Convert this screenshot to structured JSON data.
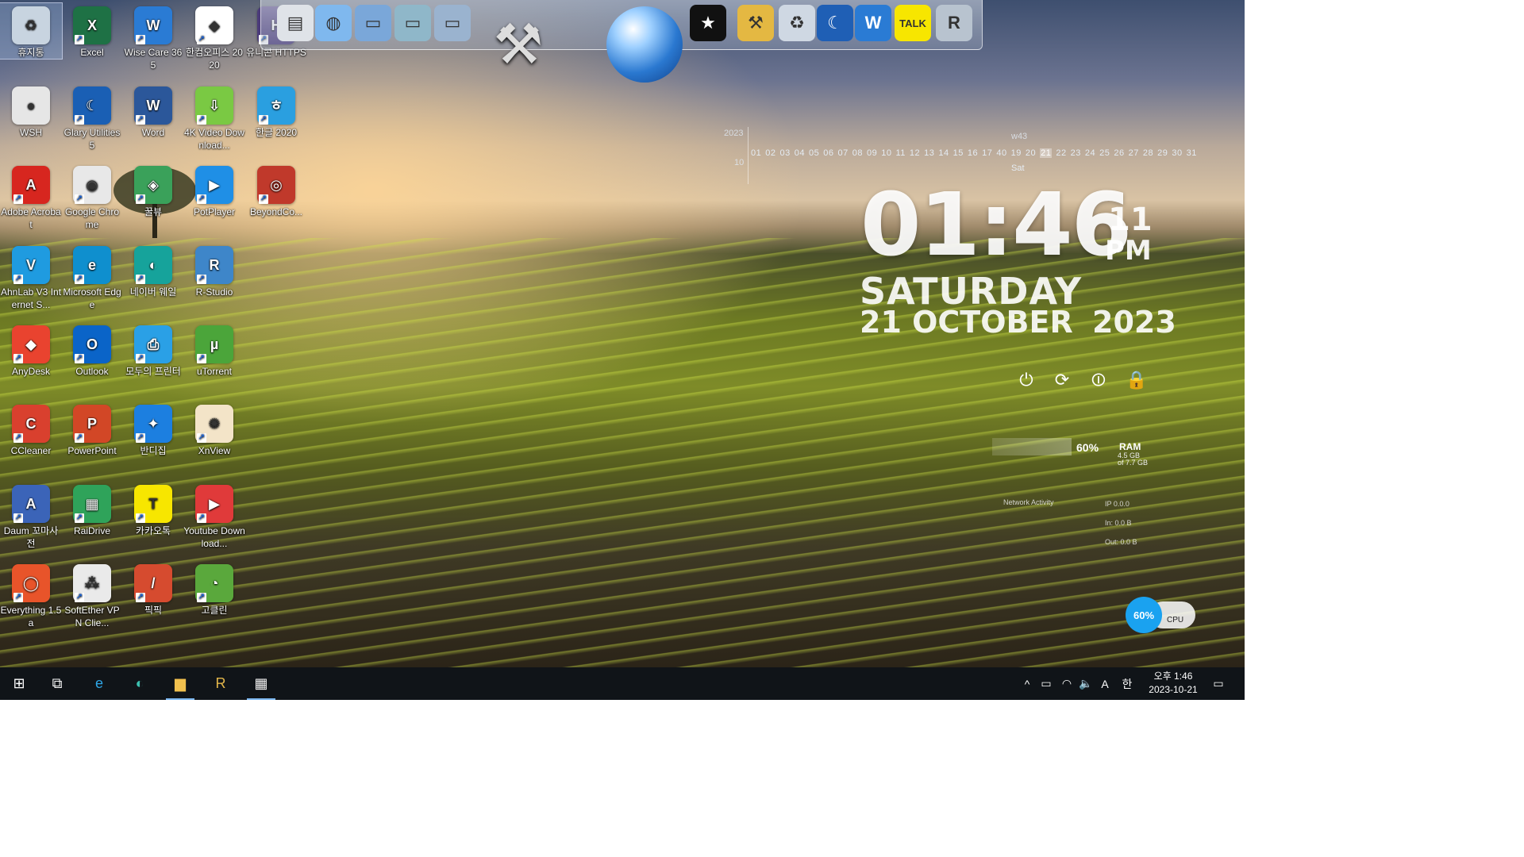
{
  "desktop_icons": [
    {
      "label": "휴지통",
      "color": "#c8d4e0",
      "glyph": "♻",
      "col": 0,
      "row": 0,
      "selected": true,
      "shortcut": false
    },
    {
      "label": "Excel",
      "color": "#1e7145",
      "glyph": "X",
      "col": 1,
      "row": 0
    },
    {
      "label": "Wise Care 365",
      "color": "#2a7bd4",
      "glyph": "W",
      "col": 2,
      "row": 0
    },
    {
      "label": "한컴오피스 2020",
      "color": "#ffffff",
      "glyph": "◆",
      "col": 3,
      "row": 0
    },
    {
      "label": "유니콘 HTTPS",
      "color": "#4b3b7a",
      "glyph": "H",
      "col": 4,
      "row": 0
    },
    {
      "label": "WSH",
      "color": "#e6e6e6",
      "glyph": "●",
      "col": 0,
      "row": 1,
      "shortcut": false
    },
    {
      "label": "Glary Utilities 5",
      "color": "#1a5fb4",
      "glyph": "☾",
      "col": 1,
      "row": 1
    },
    {
      "label": "Word",
      "color": "#2b579a",
      "glyph": "W",
      "col": 2,
      "row": 1
    },
    {
      "label": "4K Video Download...",
      "color": "#7ac943",
      "glyph": "⇩",
      "col": 3,
      "row": 1
    },
    {
      "label": "한글 2020",
      "color": "#2a9fe0",
      "glyph": "ㅎ",
      "col": 4,
      "row": 1
    },
    {
      "label": "Adobe Acrobat",
      "color": "#d7261f",
      "glyph": "A",
      "col": 0,
      "row": 2
    },
    {
      "label": "Google Chrome",
      "color": "#e8e8e8",
      "glyph": "◉",
      "col": 1,
      "row": 2
    },
    {
      "label": "꿀뷰",
      "color": "#3aa15a",
      "glyph": "◈",
      "col": 2,
      "row": 2
    },
    {
      "label": "PotPlayer",
      "color": "#1f8fe6",
      "glyph": "▶",
      "col": 3,
      "row": 2
    },
    {
      "label": "BeyondCo...",
      "color": "#c0392b",
      "glyph": "◎",
      "col": 4,
      "row": 2
    },
    {
      "label": "AhnLab V3 Internet S...",
      "color": "#1f9be0",
      "glyph": "V",
      "col": 0,
      "row": 3
    },
    {
      "label": "Microsoft Edge",
      "color": "#0f8fce",
      "glyph": "e",
      "col": 1,
      "row": 3
    },
    {
      "label": "네이버 웨일",
      "color": "#16a39b",
      "glyph": "◐",
      "col": 2,
      "row": 3
    },
    {
      "label": "R-Studio",
      "color": "#3e86c9",
      "glyph": "R",
      "col": 3,
      "row": 3
    },
    {
      "label": "AnyDesk",
      "color": "#e9432f",
      "glyph": "◆",
      "col": 0,
      "row": 4
    },
    {
      "label": "Outlook",
      "color": "#0a64c8",
      "glyph": "O",
      "col": 1,
      "row": 4
    },
    {
      "label": "모두의 프린터",
      "color": "#2aa0e6",
      "glyph": "⎙",
      "col": 2,
      "row": 4
    },
    {
      "label": "uTorrent",
      "color": "#4ba53a",
      "glyph": "µ",
      "col": 3,
      "row": 4
    },
    {
      "label": "CCleaner",
      "color": "#d9402e",
      "glyph": "C",
      "col": 0,
      "row": 5
    },
    {
      "label": "PowerPoint",
      "color": "#d24726",
      "glyph": "P",
      "col": 1,
      "row": 5
    },
    {
      "label": "반디집",
      "color": "#1c7fe0",
      "glyph": "✦",
      "col": 2,
      "row": 5
    },
    {
      "label": "XnView",
      "color": "#f3e4c8",
      "glyph": "✺",
      "col": 3,
      "row": 5
    },
    {
      "label": "Daum 꼬마사전",
      "color": "#3b64b8",
      "glyph": "A",
      "col": 0,
      "row": 6
    },
    {
      "label": "RaiDrive",
      "color": "#2fa35a",
      "glyph": "▦",
      "col": 1,
      "row": 6
    },
    {
      "label": "카카오톡",
      "color": "#f7e600",
      "glyph": "T",
      "col": 2,
      "row": 6
    },
    {
      "label": "Youtube Download...",
      "color": "#e03a3a",
      "glyph": "▶",
      "col": 3,
      "row": 6
    },
    {
      "label": "Everything 1.5a",
      "color": "#e8542a",
      "glyph": "◯",
      "col": 0,
      "row": 7
    },
    {
      "label": "SoftEther VPN Clie...",
      "color": "#eaeaea",
      "glyph": "⁂",
      "col": 1,
      "row": 7
    },
    {
      "label": "픽픽",
      "color": "#d64b2f",
      "glyph": "/",
      "col": 2,
      "row": 7
    },
    {
      "label": "고클린",
      "color": "#5aa83c",
      "glyph": "◔",
      "col": 3,
      "row": 7
    }
  ],
  "dock_items": [
    {
      "name": "notepad-icon",
      "glyph": "▤",
      "color": "#dfe3e8"
    },
    {
      "name": "network-globe-icon",
      "glyph": "◍",
      "color": "#7fb8ee"
    },
    {
      "name": "folder-icon",
      "glyph": "▭",
      "color": "#7aa7d9"
    },
    {
      "name": "folder-green-icon",
      "glyph": "▭",
      "color": "#8fb7c9"
    },
    {
      "name": "folder-open-icon",
      "glyph": "▭",
      "color": "#9ab3cf"
    },
    {
      "name": "tshirt-icon",
      "glyph": "★",
      "color": "#111111"
    },
    {
      "name": "hammer-tool-icon",
      "glyph": "⚒",
      "color": "#e4b842"
    },
    {
      "name": "recycle-bin-icon",
      "glyph": "♻",
      "color": "#cfd8e3"
    },
    {
      "name": "glary-icon",
      "glyph": "☾",
      "color": "#1f5fb5"
    },
    {
      "name": "wise-shield-icon",
      "glyph": "W",
      "color": "#2a7bd4"
    },
    {
      "name": "kakaotalk-icon",
      "glyph": "TALK",
      "color": "#f7e600"
    },
    {
      "name": "r-studio-dock-icon",
      "glyph": "R",
      "color": "#b8c3cf"
    }
  ],
  "calendar": {
    "year": "2023",
    "week": "w43",
    "month": "10",
    "days": [
      "01",
      "02",
      "03",
      "04",
      "05",
      "06",
      "07",
      "08",
      "09",
      "10",
      "11",
      "12",
      "13",
      "14",
      "15",
      "16",
      "17",
      "40",
      "19",
      "20",
      "21",
      "22",
      "23",
      "24",
      "25",
      "26",
      "27",
      "28",
      "29",
      "30",
      "31"
    ],
    "today": "21",
    "day_of_week": "Sat"
  },
  "clock": {
    "time": "01:46",
    "seconds": "11",
    "ampm": "PM",
    "day": "SATURDAY",
    "date": "21 OCTOBER",
    "year": "2023"
  },
  "power_buttons": [
    {
      "name": "shutdown-icon",
      "glyph": "⏻"
    },
    {
      "name": "restart-icon",
      "glyph": "⟳"
    },
    {
      "name": "sleep-icon",
      "glyph": "⏼"
    },
    {
      "name": "lock-icon",
      "glyph": "🔒"
    }
  ],
  "ram_widget": {
    "percent": "60%",
    "label": "RAM",
    "sub1": "4.5 GB",
    "sub2": "of 7.7 GB"
  },
  "network_widget": {
    "label": "Network Activity",
    "r1": "IP 0.0.0",
    "r2": "In: 0.0 B",
    "r3": "Out: 0.0 B"
  },
  "cpu_widget": {
    "percent": "60%",
    "label": "CPU"
  },
  "taskbar": {
    "buttons": [
      {
        "name": "start-button",
        "glyph": "⊞",
        "active": false
      },
      {
        "name": "task-view-button",
        "glyph": "⧉",
        "active": false
      },
      {
        "name": "taskbar-edge",
        "glyph": "e",
        "active": false,
        "color": "#2fa7e8"
      },
      {
        "name": "taskbar-whale",
        "glyph": "◐",
        "active": false,
        "color": "#3cc0b0"
      },
      {
        "name": "taskbar-file-explorer",
        "glyph": "▆",
        "active": true,
        "color": "#f2c14e"
      },
      {
        "name": "taskbar-r-studio",
        "glyph": "R",
        "active": false,
        "color": "#e2b64a"
      },
      {
        "name": "taskbar-store",
        "glyph": "▦",
        "active": true,
        "color": "#f3f3f3"
      }
    ],
    "tray": [
      {
        "name": "tray-chevron-icon",
        "glyph": "^"
      },
      {
        "name": "tray-battery-icon",
        "glyph": "▭"
      },
      {
        "name": "tray-wifi-icon",
        "glyph": "◠"
      },
      {
        "name": "tray-volume-icon",
        "glyph": "🔈"
      },
      {
        "name": "tray-ime-a",
        "glyph": "A"
      },
      {
        "name": "tray-ime-han",
        "glyph": "한"
      }
    ],
    "time": "오후 1:46",
    "date": "2023-10-21",
    "notification_glyph": "▭"
  }
}
